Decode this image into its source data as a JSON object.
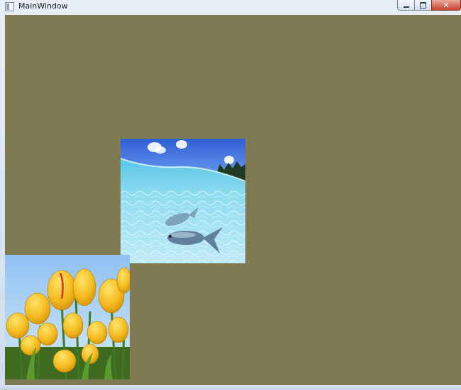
{
  "window": {
    "title": "MainWindow",
    "client_background": "#7f7a51",
    "controls": {
      "minimize_icon": "minimize-icon",
      "maximize_icon": "maximize-icon",
      "close_icon": "close-icon",
      "close_glyph": "✕"
    }
  },
  "canvas": {
    "images": [
      {
        "subject": "underwater-fish-photo"
      },
      {
        "subject": "yellow-tulips-photo"
      }
    ]
  }
}
